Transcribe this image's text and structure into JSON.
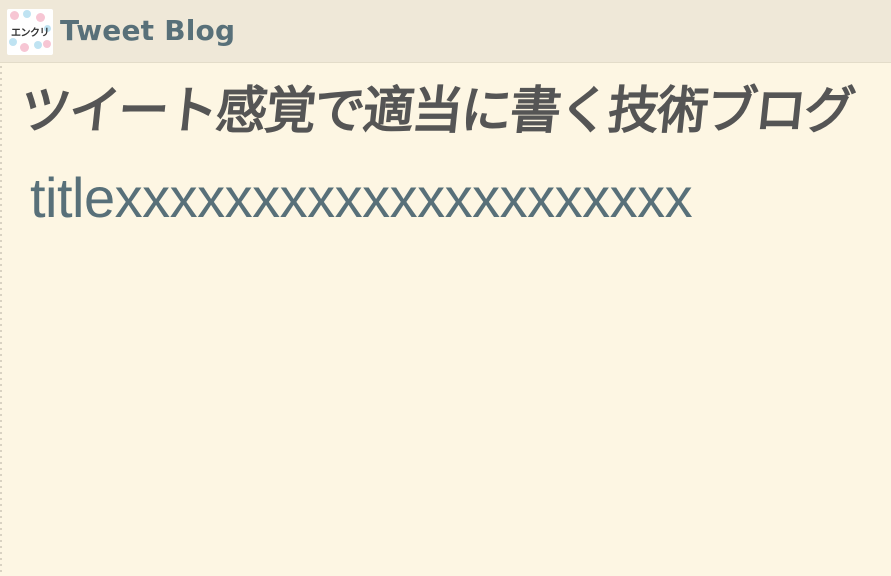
{
  "header": {
    "logo_text": "エンクリ",
    "site_name": "Tweet Blog"
  },
  "main": {
    "blog_title": "ツイート感覚で適当に書く技術ブログ",
    "post_title": "titlexxxxxxxxxxxxxxxxxxxxx"
  },
  "colors": {
    "background": "#fdf6e3",
    "header_background": "#efe8d8",
    "site_name": "#587079",
    "blog_title": "#555555",
    "post_title": "#587079"
  }
}
